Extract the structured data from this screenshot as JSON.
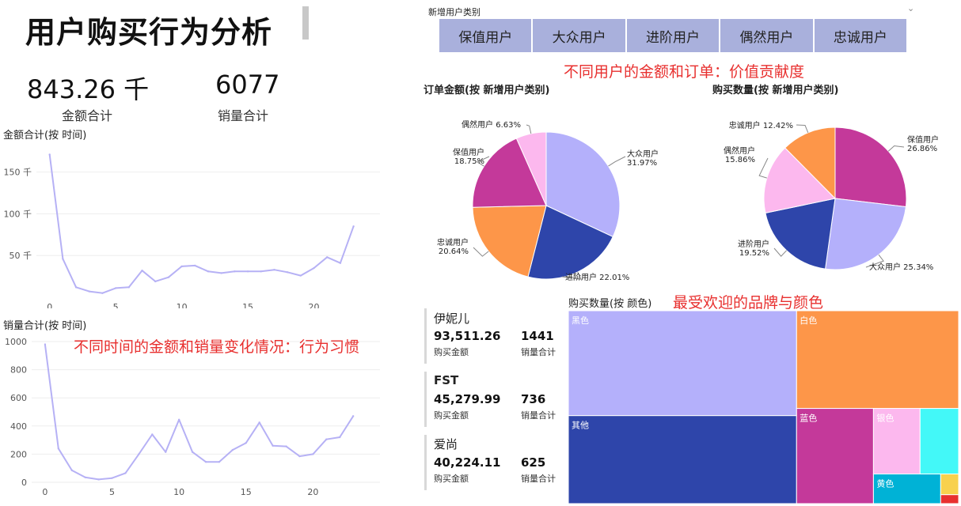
{
  "header": {
    "title": "用户购买行为分析"
  },
  "kpis": [
    {
      "value": "843.26 千",
      "label": "金额合计"
    },
    {
      "value": "6077",
      "label": "销量合计"
    }
  ],
  "slicer": {
    "label": "新增用户类别",
    "options": [
      "保值用户",
      "大众用户",
      "进阶用户",
      "偶然用户",
      "忠诚用户"
    ]
  },
  "notes": {
    "value_note": "不同用户的金额和订单：价值贡献度",
    "time_note": "不同时间的金额和销量变化情况：行为习惯",
    "brand_note": "最受欢迎的品牌与颜色"
  },
  "brand_cards": [
    {
      "brand": "伊妮儿",
      "amount": "93,511.26",
      "amount_label": "购买金额",
      "qty": "1441",
      "qty_label": "销量合计"
    },
    {
      "brand": "FST",
      "amount": "45,279.99",
      "amount_label": "购买金额",
      "qty": "736",
      "qty_label": "销量合计"
    },
    {
      "brand": "爱尚",
      "amount": "40,224.11",
      "amount_label": "购买金额",
      "qty": "625",
      "qty_label": "销量合计"
    }
  ],
  "colors": {
    "line": "#b6b1f5",
    "slicer": "#a9b0dc",
    "accent_red": "#e8302f",
    "lavender": "#b4b0fb",
    "navy": "#2e45aa",
    "orange": "#fd9649",
    "magenta": "#c4399a",
    "pink": "#fcb8ee",
    "cyan": "#43f8f8",
    "teal": "#00b2d6",
    "yellow": "#f8d14e"
  },
  "chart_data": [
    {
      "id": "amount_by_time",
      "type": "line",
      "title": "金额合计(按 时间)",
      "x": [
        0,
        1,
        2,
        3,
        4,
        5,
        6,
        7,
        8,
        9,
        10,
        11,
        12,
        13,
        14,
        15,
        16,
        17,
        18,
        19,
        20,
        21,
        22,
        23
      ],
      "y": [
        171,
        46,
        12,
        7,
        5,
        11,
        12,
        32,
        19,
        24,
        37,
        38,
        31,
        29,
        31,
        31,
        31,
        33,
        30,
        26,
        35,
        48,
        41,
        85
      ],
      "xticks": [
        "0",
        "5",
        "10",
        "15",
        "20"
      ],
      "xtick_values": [
        0,
        5,
        10,
        15,
        20
      ],
      "yticks": [
        "50 千",
        "100 千",
        "150 千"
      ],
      "ytick_values": [
        50,
        100,
        150
      ],
      "xlim": [
        -1,
        25
      ],
      "ylim": [
        0,
        180
      ],
      "grid": true
    },
    {
      "id": "qty_by_time",
      "type": "line",
      "title": "销量合计(按 时间)",
      "x": [
        0,
        1,
        2,
        3,
        4,
        5,
        6,
        7,
        8,
        9,
        10,
        11,
        12,
        13,
        14,
        15,
        16,
        17,
        18,
        19,
        20,
        21,
        22,
        23
      ],
      "y": [
        980,
        240,
        85,
        35,
        20,
        30,
        65,
        200,
        340,
        215,
        445,
        215,
        145,
        145,
        230,
        280,
        425,
        260,
        255,
        185,
        200,
        305,
        320,
        470
      ],
      "xticks": [
        "0",
        "5",
        "10",
        "15",
        "20"
      ],
      "xtick_values": [
        0,
        5,
        10,
        15,
        20
      ],
      "yticks": [
        "0",
        "200",
        "400",
        "600",
        "800",
        "1000"
      ],
      "ytick_values": [
        0,
        200,
        400,
        600,
        800,
        1000
      ],
      "xlim": [
        -1,
        25
      ],
      "ylim": [
        0,
        1000
      ],
      "grid": true
    },
    {
      "id": "order_amount_pie",
      "type": "pie",
      "title": "订单金额(按 新增用户类别)",
      "slices": [
        {
          "name": "大众用户",
          "value": 31.97,
          "label": "31.97%",
          "color": "#b4b0fb"
        },
        {
          "name": "进阶用户",
          "value": 22.01,
          "label": "22.01%",
          "color": "#2e45aa"
        },
        {
          "name": "忠诚用户",
          "value": 20.64,
          "label": "20.64%",
          "color": "#fd9649"
        },
        {
          "name": "保值用户",
          "value": 18.75,
          "label": "18.75%",
          "color": "#c4399a"
        },
        {
          "name": "偶然用户",
          "value": 6.63,
          "label": "6.63%",
          "color": "#fcb8ee"
        }
      ]
    },
    {
      "id": "purchase_qty_pie",
      "type": "pie",
      "title": "购买数量(按 新增用户类别)",
      "slices": [
        {
          "name": "保值用户",
          "value": 26.86,
          "label": "26.86%",
          "color": "#c4399a"
        },
        {
          "name": "大众用户",
          "value": 25.34,
          "label": "25.34%",
          "color": "#b4b0fb"
        },
        {
          "name": "进阶用户",
          "value": 19.52,
          "label": "19.52%",
          "color": "#2e45aa"
        },
        {
          "name": "偶然用户",
          "value": 15.86,
          "label": "15.86%",
          "color": "#fcb8ee"
        },
        {
          "name": "忠诚用户",
          "value": 12.42,
          "label": "12.42%",
          "color": "#fd9649"
        }
      ]
    },
    {
      "id": "qty_by_color_treemap",
      "type": "treemap",
      "title": "购买数量(按 颜色)",
      "items": [
        {
          "name": "黑色",
          "value": 1800,
          "color": "#b4b0fb"
        },
        {
          "name": "其他",
          "value": 1510,
          "color": "#2e45aa"
        },
        {
          "name": "白色",
          "value": 1190,
          "color": "#fd9649"
        },
        {
          "name": "蓝色",
          "value": 550,
          "color": "#c4399a"
        },
        {
          "name": "银色",
          "value": 230,
          "color": "#fcb8ee"
        },
        {
          "name": "",
          "value": 190,
          "color": "#43f8f8"
        },
        {
          "name": "黄色",
          "value": 150,
          "color": "#00b2d6"
        },
        {
          "name": "",
          "value": 28,
          "color": "#f8d14e"
        },
        {
          "name": "",
          "value": 12,
          "color": "#e8302f"
        }
      ]
    }
  ]
}
